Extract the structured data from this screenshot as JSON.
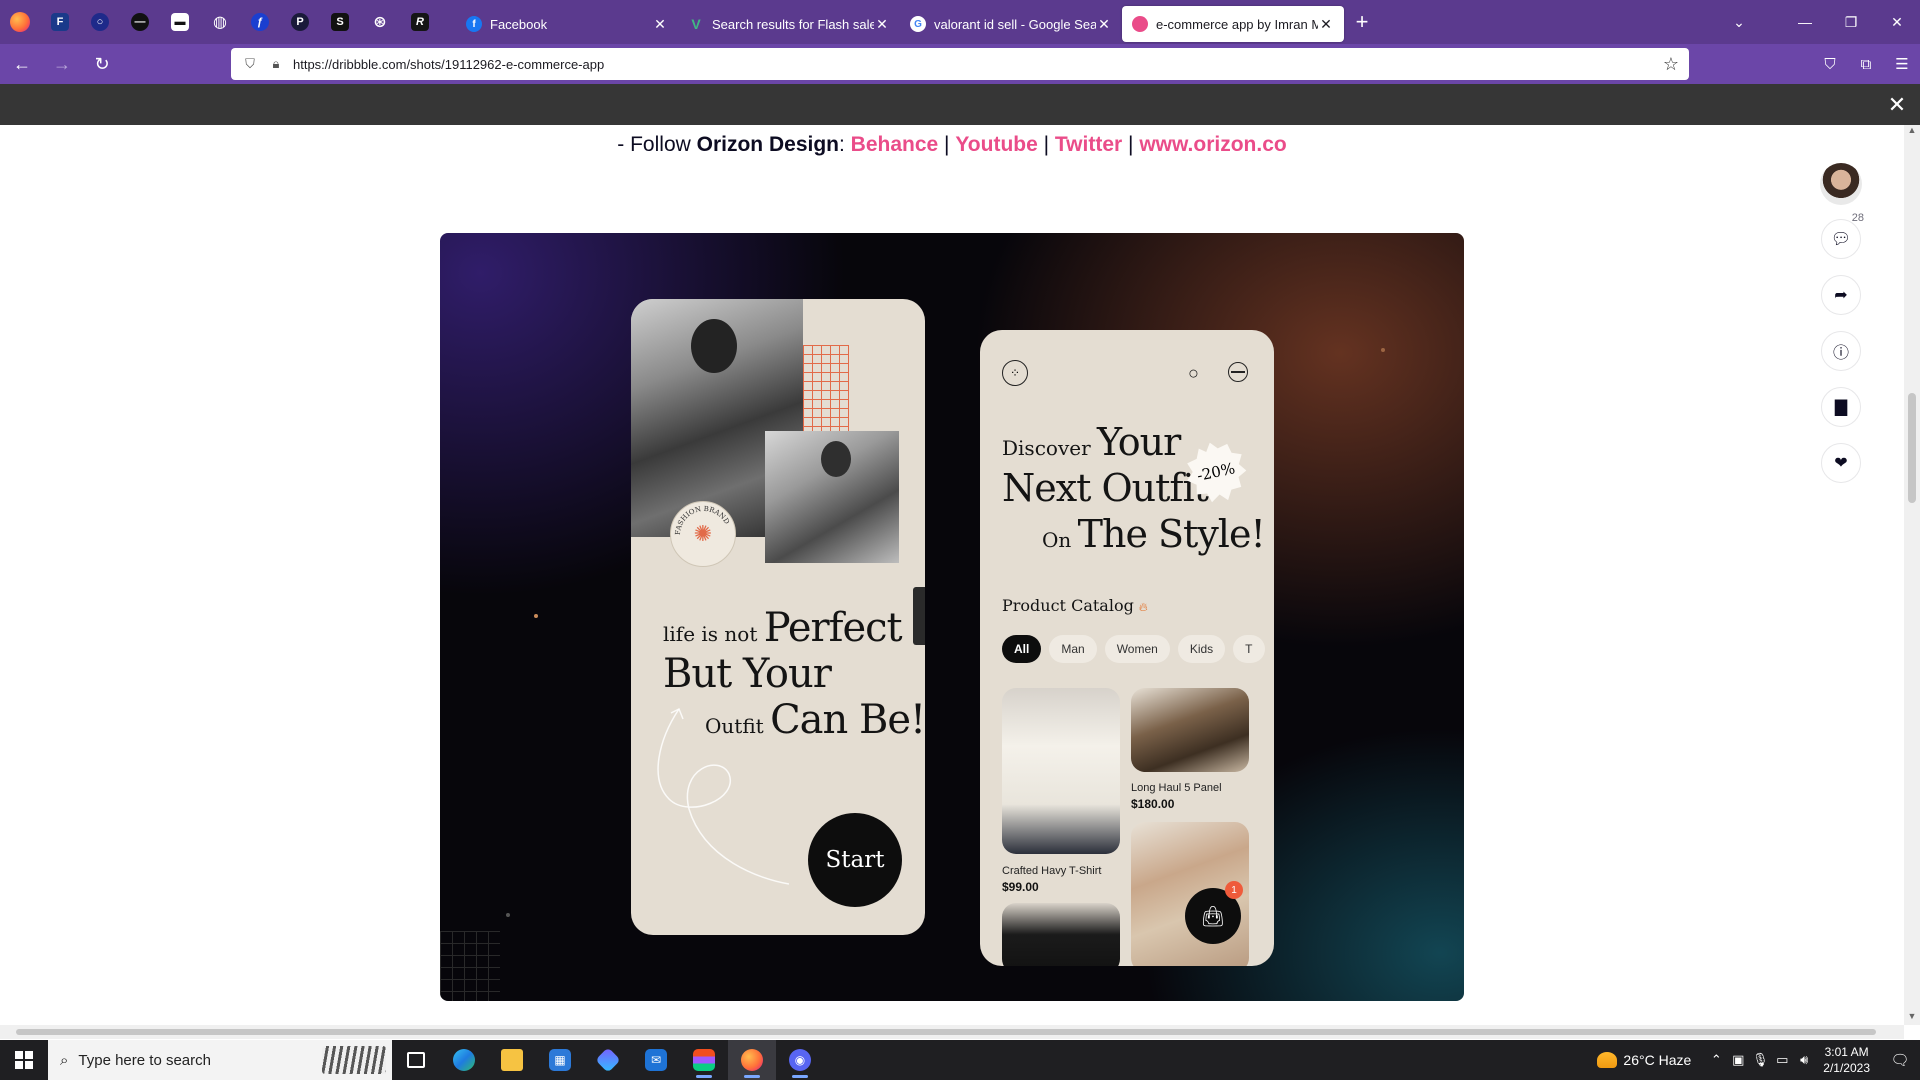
{
  "browser": {
    "tabs": [
      {
        "title": "Facebook",
        "favicon_color": "#1877f2",
        "favicon_glyph": "f"
      },
      {
        "title": "Search results for Flash sale - Fli",
        "favicon_color": "#2aa36b",
        "favicon_glyph": "V"
      },
      {
        "title": "valorant id sell - Google Search",
        "favicon_color": "#ffffff",
        "favicon_glyph": "G"
      },
      {
        "title": "e-commerce app by Imran Mol",
        "favicon_color": "#ea4c89",
        "favicon_glyph": ""
      }
    ],
    "new_tab_label": "+",
    "url": "https://dribbble.com/shots/19112962-e-commerce-app",
    "pinned_icons": [
      "f-app-icon",
      "circle-app-icon",
      "dash-app-icon",
      "chat-app-icon",
      "globe-icon",
      "bolt-app-icon",
      "p-app-icon",
      "s-app-icon",
      "globe-gear-icon",
      "r-app-icon"
    ]
  },
  "page": {
    "follow": {
      "prefix": "- Follow ",
      "brand": "Orizon Design",
      "colon": ": ",
      "links": [
        "Behance",
        "Youtube",
        "Twitter",
        "www.orizon.co"
      ],
      "separator": " | "
    },
    "comments_count": "28",
    "accent_color": "#ea4c89"
  },
  "shot": {
    "phone1": {
      "line1_small": "life is not ",
      "line1_large": "Perfect",
      "line2_large": "But Your",
      "line3_small": "Outfit ",
      "line3_large": "Can Be!",
      "start_label": "Start",
      "badge_text": "FASHION BRAND"
    },
    "phone2": {
      "head1_small": "Discover ",
      "head1_large": "Your",
      "head2_large": "Next Outfit",
      "head3_small": "On ",
      "head3_large": "The Style!",
      "discount": "-20%",
      "catalog_title": "Product Catalog",
      "categories": [
        "All",
        "Man",
        "Women",
        "Kids",
        "T"
      ],
      "products": [
        {
          "name": "Crafted Havy T-Shirt",
          "price": "$99.00"
        },
        {
          "name": "Long Haul 5 Panel",
          "price": "$180.00"
        }
      ],
      "cart_count": "1"
    }
  },
  "taskbar": {
    "search_placeholder": "Type here to search",
    "weather": "26°C  Haze",
    "time": "3:01 AM",
    "date": "2/1/2023"
  }
}
